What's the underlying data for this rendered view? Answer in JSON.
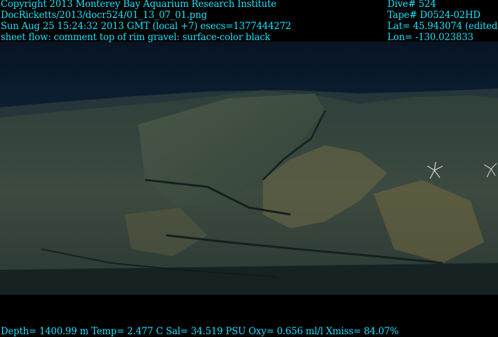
{
  "header_left": {
    "copyright": "Copyright 2013 Monterey Bay Aquarium Research Institute",
    "file_path": "DocRicketts/2013/docr524/01_13_07_01.png",
    "timestamp": "Sun Aug 25 15:24:32 2013 GMT (local +7)  esecs=1377444272",
    "comment": "sheet flow: comment top of rim gravel: surface-color black"
  },
  "header_right": {
    "dive": "Dive# 524",
    "tape": "Tape# D0524-02HD",
    "lat": "Lat= 45.943074 (edited)",
    "lon": "Lon= -130.023833"
  },
  "footer": {
    "telemetry": "Depth= 1400.99 m  Temp= 2.477 C  Sal= 34.519 PSU  Oxy= 0.656 ml/l  Xmiss= 84.07%"
  },
  "colors": {
    "overlay_text": "#19e3ff",
    "water": "#0c1f33",
    "rock_dark": "#24342f",
    "rock_light": "#6f6a45"
  }
}
